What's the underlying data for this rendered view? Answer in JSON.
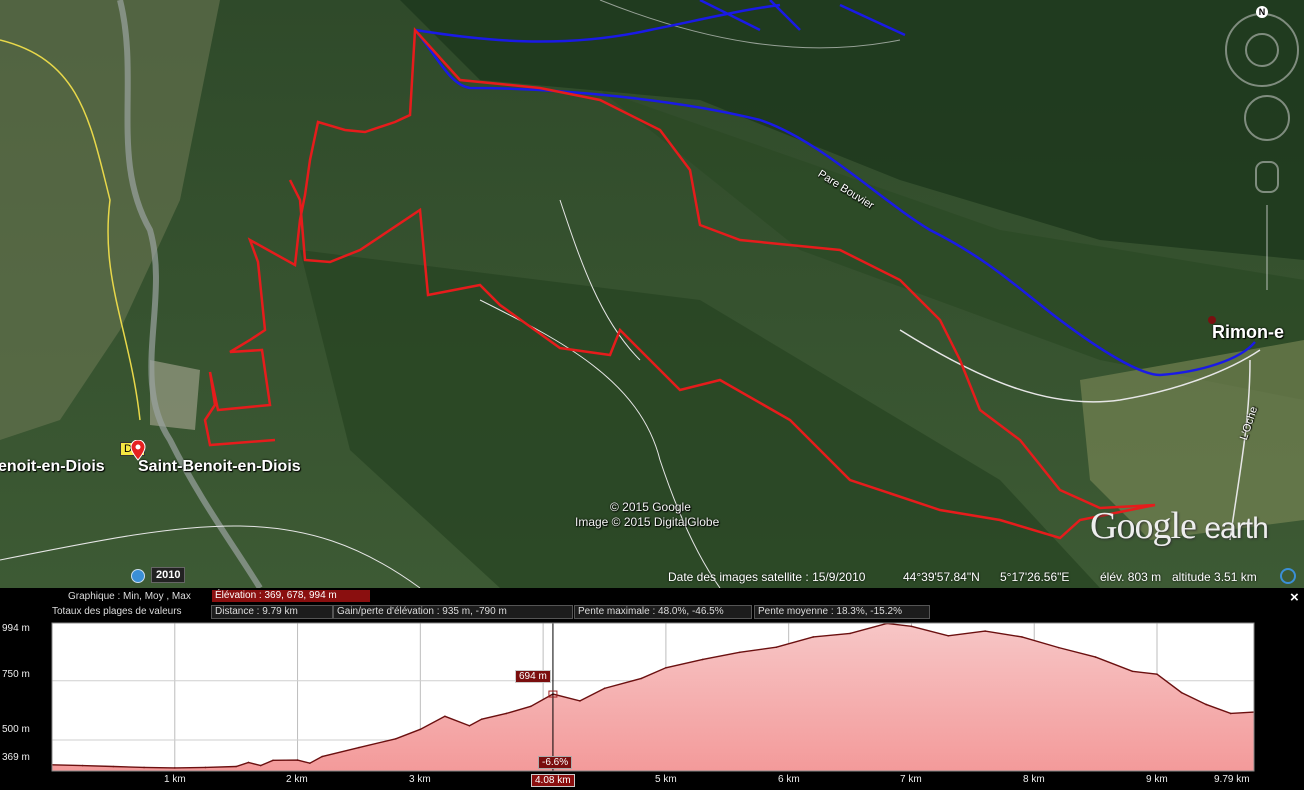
{
  "map": {
    "towns": [
      "enoit-en-Diois",
      "Saint-Benoit-en-Diois",
      "Rimon-e"
    ],
    "road_labels": [
      "Pare Bouvier",
      "L'Oche"
    ],
    "road_badge": "D 5",
    "copyright_1": "© 2015 Google",
    "copyright_2": "Image © 2015 DigitalGlobe",
    "logo_google": "Google",
    "logo_earth": "earth",
    "year": "2010",
    "compass_north": "N",
    "colors": {
      "route_red": "#e61c1c",
      "route_blue": "#1a1ae6"
    }
  },
  "status": {
    "image_date": "Date des images satellite : 15/9/2010",
    "lat": "44°39'57.84\"N",
    "lon": "5°17'26.56\"E",
    "elev": "élév.  803 m",
    "altitude": "altitude   3.51 km"
  },
  "profile": {
    "graph_label": "Graphique : Min, Moy , Max",
    "elevation_summary": "Élévation : 369, 678, 994 m",
    "ranges_label": "Totaux des plages de valeurs",
    "distance": "Distance : 9.79 km",
    "gain_loss": "Gain/perte d'élévation : 935 m, -790 m",
    "max_slope": "Pente maximale : 48.0%, -46.5%",
    "avg_slope": "Pente moyenne : 18.3%, -15.2%",
    "close": "×",
    "y_ticks": [
      "994 m",
      "750 m",
      "500 m",
      "369 m"
    ],
    "x_ticks": [
      "1 km",
      "2 km",
      "3 km",
      "4.08 km",
      "5 km",
      "6 km",
      "7 km",
      "8 km",
      "9 km",
      "9.79 km"
    ],
    "cursor_elev": "694 m",
    "cursor_slope": "-6.6%",
    "cursor_dist": "4.08 km"
  },
  "chart_data": {
    "type": "area",
    "xlabel": "",
    "ylabel": "",
    "xlim": [
      0,
      9.79
    ],
    "ylim": [
      369,
      994
    ],
    "x": [
      0,
      0.25,
      0.5,
      0.75,
      1.0,
      1.25,
      1.5,
      1.6,
      1.7,
      1.8,
      2.0,
      2.1,
      2.2,
      2.5,
      2.8,
      3.0,
      3.2,
      3.4,
      3.5,
      3.7,
      3.9,
      4.08,
      4.3,
      4.5,
      4.8,
      5.0,
      5.3,
      5.6,
      5.9,
      6.2,
      6.5,
      6.8,
      7.0,
      7.3,
      7.6,
      7.9,
      8.2,
      8.5,
      8.8,
      9.0,
      9.2,
      9.4,
      9.6,
      9.79
    ],
    "y": [
      395,
      392,
      388,
      384,
      382,
      384,
      388,
      405,
      392,
      414,
      415,
      402,
      430,
      468,
      505,
      545,
      600,
      560,
      588,
      612,
      642,
      694,
      665,
      718,
      760,
      805,
      840,
      870,
      892,
      935,
      950,
      992,
      980,
      940,
      960,
      935,
      890,
      850,
      790,
      778,
      700,
      650,
      612,
      618
    ]
  }
}
